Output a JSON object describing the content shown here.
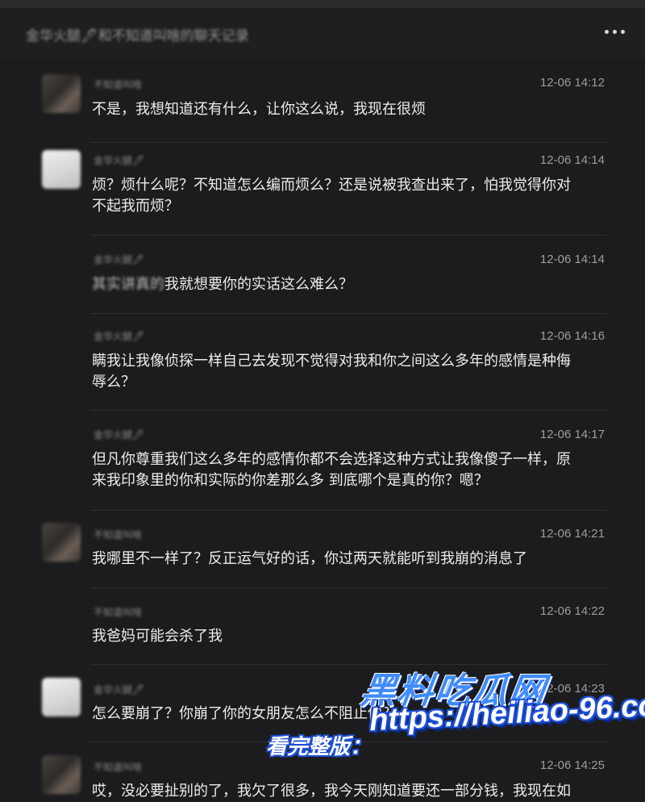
{
  "header": {
    "title": "金华火腿🖋和不知道叫啥的聊天记录",
    "more_icon": "more-horizontal-icon"
  },
  "messages": [
    {
      "sender": "不知道叫啥",
      "avatar": "a",
      "time": "12-06 14:12",
      "lines": [
        "不是，我想知道还有什么，让你这么说，我现在很烦"
      ]
    },
    {
      "sender": "金华火腿🖋",
      "avatar": "b",
      "time": "12-06 14:14",
      "lines": [
        "烦？烦什么呢？不知道怎么编而烦么？还是说被我查出来了，怕我觉得你对",
        "不起我而烦？"
      ]
    },
    {
      "sender": "金华火腿🖋",
      "avatar": "",
      "time": "12-06 14:14",
      "blurred_prefix": "其实讲真的",
      "lines": [
        "我就想要你的实话这么难么？"
      ]
    },
    {
      "sender": "金华火腿🖋",
      "avatar": "",
      "time": "12-06 14:16",
      "lines": [
        "瞒我让我像侦探一样自己去发现不觉得对我和你之间这么多年的感情是种侮",
        "辱么？"
      ]
    },
    {
      "sender": "金华火腿🖋",
      "avatar": "",
      "time": "12-06 14:17",
      "lines": [
        "但凡你尊重我们这么多年的感情你都不会选择这种方式让我像傻子一样，原",
        "来我印象里的你和实际的你差那么多 到底哪个是真的你？嗯？"
      ]
    },
    {
      "sender": "不知道叫啥",
      "avatar": "a",
      "time": "12-06 14:21",
      "lines": [
        "我哪里不一样了？反正运气好的话，你过两天就能听到我崩的消息了"
      ]
    },
    {
      "sender": "不知道叫啥",
      "avatar": "",
      "time": "12-06 14:22",
      "lines": [
        "我爸妈可能会杀了我"
      ]
    },
    {
      "sender": "金华火腿🖋",
      "avatar": "b",
      "time": "12-06 14:23",
      "lines": [
        "怎么要崩了？你崩了你的女朋友怎么不阻止你？"
      ]
    },
    {
      "sender": "不知道叫啥",
      "avatar": "a",
      "time": "12-06 14:25",
      "lines": [
        "哎，没必要扯别的了，我欠了很多，我今天刚知道要还一部分钱，我现在如"
      ]
    }
  ],
  "watermark": {
    "brand": "黑料吃瓜网",
    "url": "https://heiliao-96.com",
    "prefix": "看完整版：",
    "url_short": "https://heiliao-96.com"
  }
}
